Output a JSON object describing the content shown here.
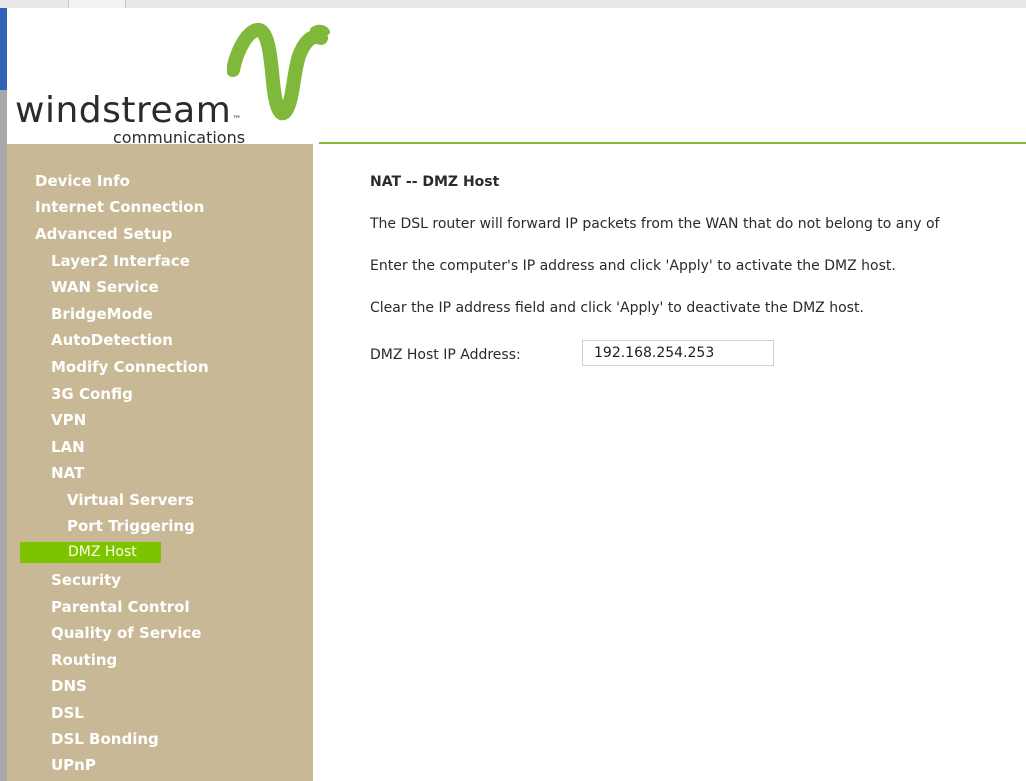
{
  "brand": {
    "logo_text": "windstream",
    "logo_tm": "™",
    "logo_sub": "communications",
    "accent_color": "#86b83c"
  },
  "sidebar": {
    "items": [
      {
        "label": "Device Info",
        "level": 0
      },
      {
        "label": "Internet Connection",
        "level": 0
      },
      {
        "label": "Advanced Setup",
        "level": 0
      },
      {
        "label": "Layer2 Interface",
        "level": 1
      },
      {
        "label": "WAN Service",
        "level": 1
      },
      {
        "label": "BridgeMode",
        "level": 1
      },
      {
        "label": "AutoDetection",
        "level": 1
      },
      {
        "label": "Modify Connection",
        "level": 1
      },
      {
        "label": "3G Config",
        "level": 1
      },
      {
        "label": "VPN",
        "level": 1
      },
      {
        "label": "LAN",
        "level": 1
      },
      {
        "label": "NAT",
        "level": 1
      },
      {
        "label": "Virtual Servers",
        "level": 2
      },
      {
        "label": "Port Triggering",
        "level": 2
      },
      {
        "label": "DMZ Host",
        "level": 2,
        "active": true
      },
      {
        "label": "Security",
        "level": 1
      },
      {
        "label": "Parental Control",
        "level": 1
      },
      {
        "label": "Quality of Service",
        "level": 1
      },
      {
        "label": "Routing",
        "level": 1
      },
      {
        "label": "DNS",
        "level": 1
      },
      {
        "label": "DSL",
        "level": 1
      },
      {
        "label": "DSL Bonding",
        "level": 1
      },
      {
        "label": "UPnP",
        "level": 1
      }
    ]
  },
  "main": {
    "title": "NAT -- DMZ Host",
    "paragraphs": [
      "The DSL router will forward IP packets from the WAN that do not belong to any of",
      "Enter the computer's IP address and click 'Apply' to activate the DMZ host.",
      "Clear the IP address field and click 'Apply' to deactivate the DMZ host."
    ],
    "field_label": "DMZ Host IP Address:",
    "field_value": "192.168.254.253"
  }
}
